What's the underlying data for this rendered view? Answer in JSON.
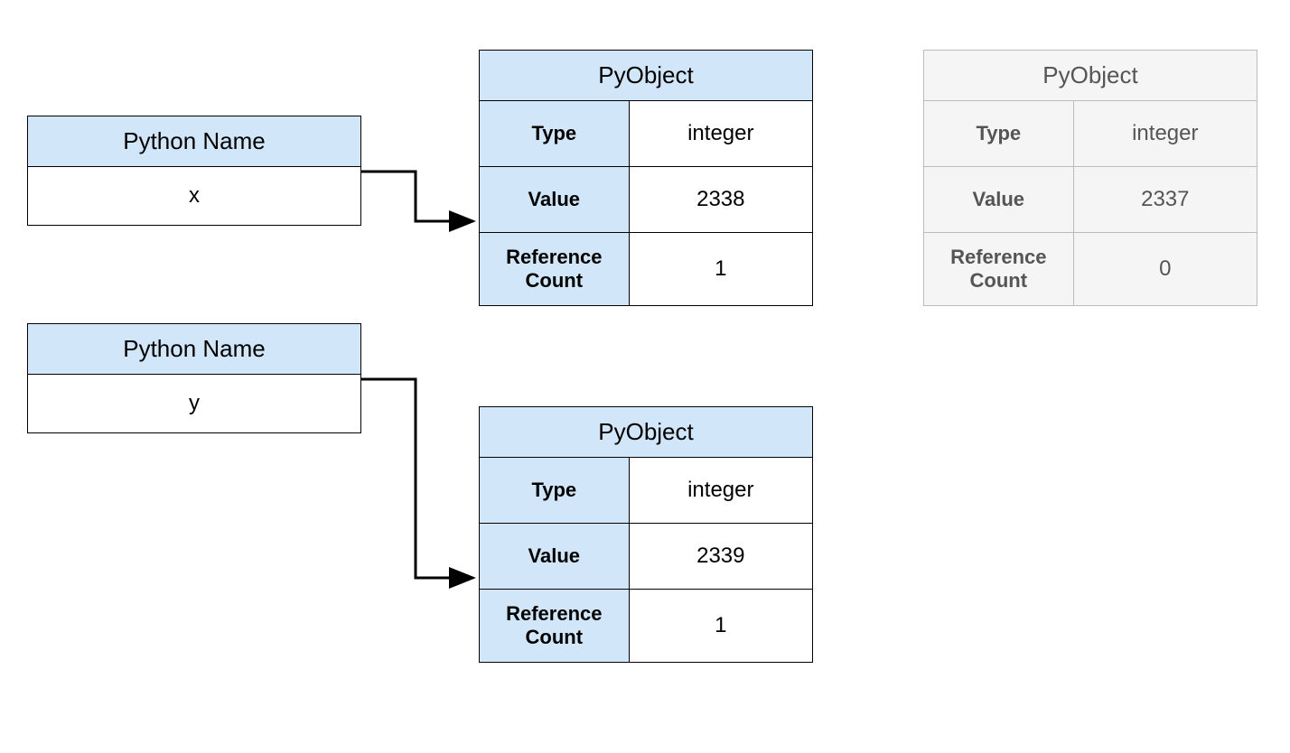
{
  "names": {
    "header": "Python Name",
    "x": {
      "value": "x"
    },
    "y": {
      "value": "y"
    }
  },
  "pyobject_labels": {
    "header": "PyObject",
    "type": "Type",
    "value": "Value",
    "refcount": "Reference Count"
  },
  "objects": {
    "obj1": {
      "type": "integer",
      "value": "2338",
      "refcount": "1"
    },
    "obj2": {
      "type": "integer",
      "value": "2339",
      "refcount": "1"
    },
    "obj3": {
      "type": "integer",
      "value": "2337",
      "refcount": "0"
    }
  }
}
